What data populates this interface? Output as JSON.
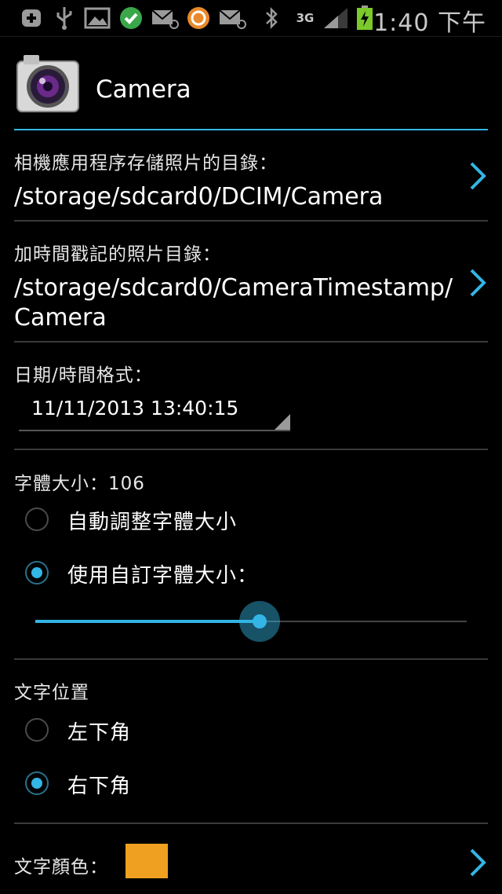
{
  "status_bar": {
    "time": "1:40 下午",
    "network": "3G",
    "icons": [
      "add-icon",
      "usb-icon",
      "gallery-icon",
      "check-icon",
      "mail-icon",
      "app-icon",
      "mail-icon",
      "bluetooth-icon",
      "signal-icon",
      "battery-icon"
    ]
  },
  "header": {
    "title": "Camera"
  },
  "settings": {
    "camera_dir": {
      "label": "相機應用程序存儲照片的目錄：",
      "value": "/storage/sdcard0/DCIM/Camera"
    },
    "timestamp_dir": {
      "label": "加時間戳記的照片目錄：",
      "value_line1": "/storage/sdcard0/CameraTimestamp/",
      "value_line2": "Camera"
    },
    "date_format": {
      "label": "日期/時間格式：",
      "value": "11/11/2013 13:40:15"
    },
    "font_size": {
      "label": "字體大小：106",
      "options": [
        {
          "label": "自動調整字體大小",
          "selected": false
        },
        {
          "label": "使用自訂字體大小：",
          "selected": true
        }
      ],
      "slider_fraction": 0.52
    },
    "text_position": {
      "label": "文字位置",
      "options": [
        {
          "label": "左下角",
          "selected": false
        },
        {
          "label": "右下角",
          "selected": true
        }
      ]
    },
    "text_color": {
      "label": "文字顏色：",
      "color": "#f0a020"
    }
  },
  "colors": {
    "accent": "#33b5e5",
    "background": "#000000"
  }
}
